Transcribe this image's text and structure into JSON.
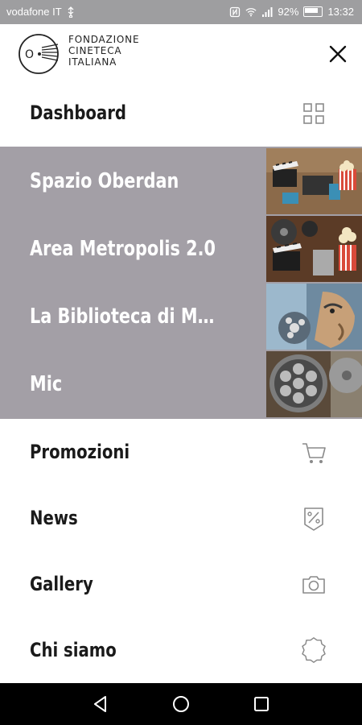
{
  "status_bar": {
    "carrier": "vodafone IT",
    "battery": "92%",
    "time": "13:32",
    "color": "#9e9ea0"
  },
  "header": {
    "brand_lines": [
      "FONDAZIONE",
      "CINETECA",
      "ITALIANA"
    ],
    "logo_icon": "cineteca-logo",
    "close_icon": "close-icon"
  },
  "menu": {
    "dashboard": {
      "label": "Dashboard",
      "icon": "grid-icon"
    },
    "spaces": [
      {
        "label": "Spazio Oberdan",
        "thumb": "clapperboard-popcorn-photo"
      },
      {
        "label": "Area Metropolis 2.0",
        "thumb": "film-reels-popcorn-photo"
      },
      {
        "label": "La Biblioteca di M…",
        "thumb": "mural-film-reel-photo"
      },
      {
        "label": "Mic",
        "thumb": "film-reel-closeup-photo"
      }
    ],
    "items": [
      {
        "label": "Promozioni",
        "icon": "cart-icon"
      },
      {
        "label": "News",
        "icon": "percent-tag-icon"
      },
      {
        "label": "Gallery",
        "icon": "camera-icon"
      },
      {
        "label": "Chi siamo",
        "icon": "badge-icon"
      }
    ]
  },
  "colors": {
    "highlight": "#a39fa6",
    "text": "#1a1a1a",
    "icon": "#8a8a8a"
  }
}
